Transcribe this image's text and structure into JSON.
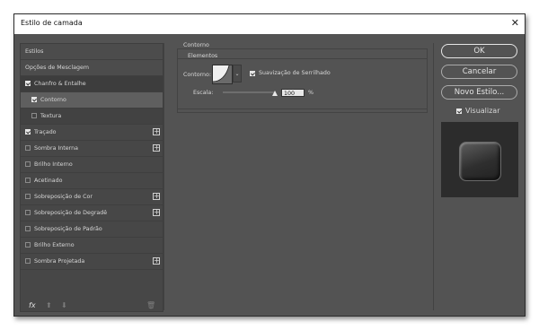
{
  "window": {
    "title": "Estilo de camada",
    "close_glyph": "✕"
  },
  "left_panel": {
    "estilos_label": "Estilos",
    "mesclagem_label": "Opções de Mesclagem",
    "bevel": {
      "label": "Chanfro & Entalhe",
      "checked": true
    },
    "contorno": {
      "label": "Contorno",
      "checked": true
    },
    "textura": {
      "label": "Textura",
      "checked": false
    },
    "tracado": {
      "label": "Traçado",
      "checked": true
    },
    "sombra_interna": {
      "label": "Sombra Interna",
      "checked": false
    },
    "brilho_interno": {
      "label": "Brilho Interno",
      "checked": false
    },
    "acetinado": {
      "label": "Acetinado",
      "checked": false
    },
    "sobre_cor": {
      "label": "Sobreposição de Cor",
      "checked": false
    },
    "sobre_degrade": {
      "label": "Sobreposição de Degradê",
      "checked": false
    },
    "sobre_padrao": {
      "label": "Sobreposição de Padrão",
      "checked": false
    },
    "brilho_externo": {
      "label": "Brilho Externo",
      "checked": false
    },
    "sombra_projetada": {
      "label": "Sombra Projetada",
      "checked": false
    },
    "plus_glyph": "+",
    "footer": {
      "fx": "fx",
      "up": "⬆",
      "down": "⬇",
      "trash": "🗑"
    }
  },
  "contour": {
    "group_title": "Contorno",
    "elements_title": "Elementos",
    "contour_label": "Contorno:",
    "dropdown_glyph": "⌄",
    "antialias_label": "Suavização de Serrilhado",
    "antialias_checked": true,
    "range_label": "Escala:",
    "range_value": "100",
    "range_unit": "%"
  },
  "buttons": {
    "ok": "OK",
    "cancel": "Cancelar",
    "new_style": "Novo Estilo..."
  },
  "preview": {
    "label": "Visualizar",
    "checked": true
  }
}
